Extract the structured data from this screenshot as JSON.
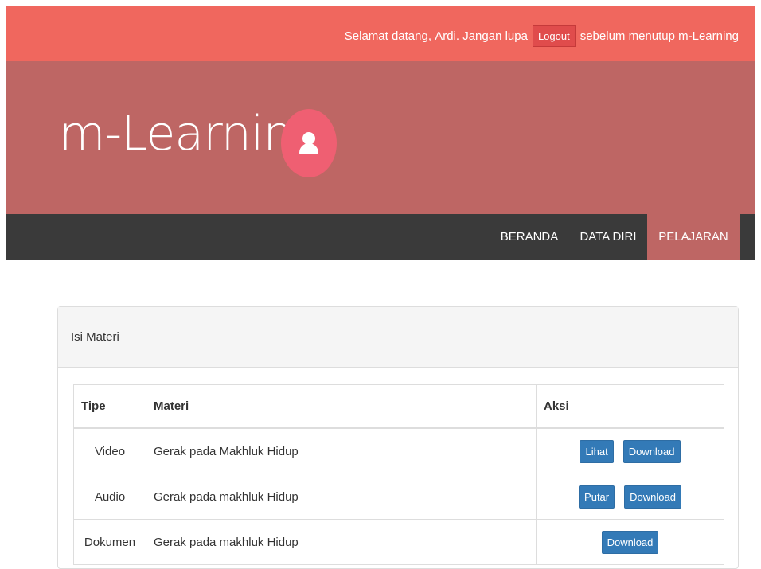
{
  "header": {
    "welcome_prefix": "Selamat datang,",
    "user_name": "Ardi",
    "welcome_middle": ". Jangan lupa",
    "logout_label": "Logout",
    "welcome_suffix": "sebelum menutup m-Learning"
  },
  "hero": {
    "logo_text": "m-Learning",
    "avatar_icon": "user-icon"
  },
  "nav": {
    "items": [
      {
        "label": "BERANDA"
      },
      {
        "label": "DATA DIRI"
      },
      {
        "label": "PELAJARAN",
        "active": true
      }
    ]
  },
  "panel": {
    "title": "Isi Materi",
    "columns": [
      "Tipe",
      "Materi",
      "Aksi"
    ],
    "rows": [
      {
        "tipe": "Video",
        "materi": "Gerak pada Makhluk Hidup",
        "actions": [
          "Lihat",
          "Download"
        ]
      },
      {
        "tipe": "Audio",
        "materi": "Gerak pada makhluk Hidup",
        "actions": [
          "Putar",
          "Download"
        ]
      },
      {
        "tipe": "Dokumen",
        "materi": "Gerak pada makhluk Hidup",
        "actions": [
          "Download"
        ]
      }
    ]
  },
  "colors": {
    "topbar": "#f0675e",
    "hero": "#be6664",
    "navbar": "#3a3a3a",
    "button": "#337ab7"
  }
}
